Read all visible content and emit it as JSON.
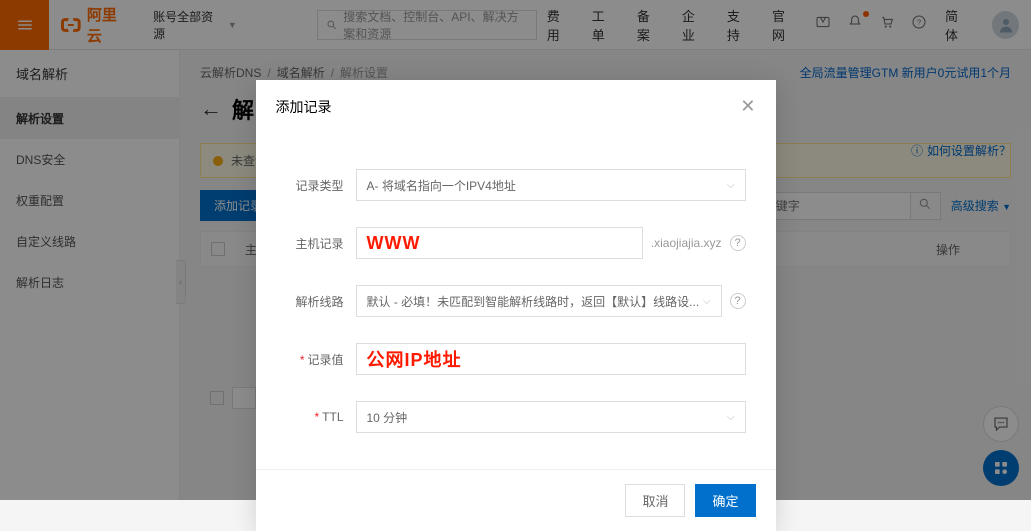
{
  "header": {
    "brand": "阿里云",
    "account_scope": "账号全部资源",
    "search_placeholder": "搜索文档、控制台、API、解决方案和资源",
    "nav": [
      "费用",
      "工单",
      "备案",
      "企业",
      "支持",
      "官网"
    ],
    "lang": "简体"
  },
  "sidebar": {
    "title": "域名解析",
    "items": [
      "解析设置",
      "DNS安全",
      "权重配置",
      "自定义线路",
      "解析日志"
    ],
    "active_index": 0
  },
  "breadcrumb": [
    "云解析DNS",
    "域名解析",
    "解析设置"
  ],
  "page": {
    "title_visible": "解",
    "promo": "全局流量管理GTM 新用户0元试用1个月",
    "help": "如何设置解析？",
    "alert": "未查询到",
    "add_button": "添加记录",
    "search_placeholder": "输入关键字",
    "adv_search": "高级搜索",
    "columns": {
      "host": "主",
      "op": "操作"
    }
  },
  "modal": {
    "title": "添加记录",
    "fields": {
      "record_type": {
        "label": "记录类型",
        "value": "A- 将域名指向一个IPV4地址"
      },
      "host": {
        "label": "主机记录",
        "overlay": "WWW",
        "suffix": ".xiaojiajia.xyz"
      },
      "route": {
        "label": "解析线路",
        "value": "默认 - 必填！未匹配到智能解析线路时，返回【默认】线路设..."
      },
      "value": {
        "label": "记录值",
        "overlay": "公网IP地址"
      },
      "ttl": {
        "label": "TTL",
        "value": "10 分钟"
      }
    },
    "cancel": "取消",
    "confirm": "确定"
  }
}
